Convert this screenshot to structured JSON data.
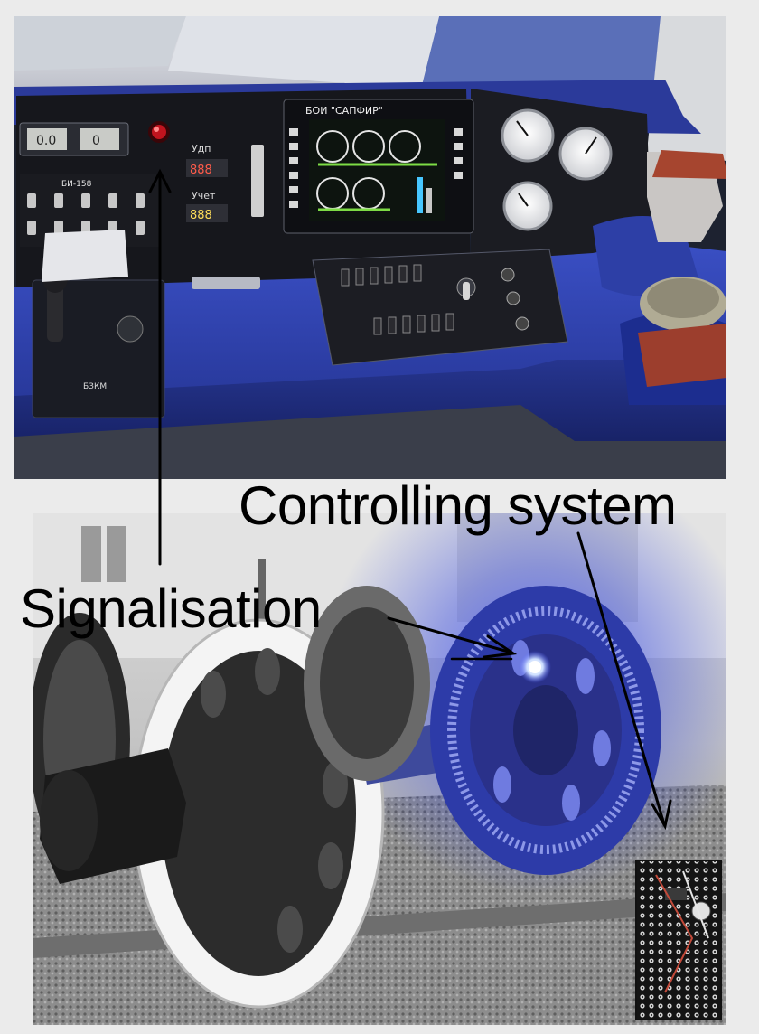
{
  "labels": {
    "controlling_system": "Controlling system",
    "signalisation": "Signalisation"
  },
  "panel_text": {
    "boi_title": "БОИ \"САПФИР\"",
    "bkm": "БЗКМ",
    "bi": "БИ-158",
    "udp": "Удп",
    "uchet": "Учет"
  },
  "colors": {
    "console_blue": "#2d3fa6",
    "led_blue": "#5a6cff",
    "led_red": "#c0141e",
    "poster_bg": "#ebebeb"
  }
}
